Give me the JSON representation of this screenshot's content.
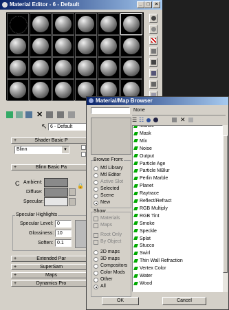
{
  "material_editor": {
    "title": "Material Editor - 6 - Default",
    "caption_buttons": [
      "_",
      "□",
      "×"
    ],
    "material_name": "6 - Default",
    "shader_rollout": "Shader Basic P",
    "shader_type": "Blinn",
    "blinn_rollout": "Blinn Basic Pa",
    "ambient_label": "Ambient:",
    "diffuse_label": "Diffuse:",
    "specular_label": "Specular:",
    "spec_highlights_label": "Specular Highlights",
    "specular_level_label": "Specular Level:",
    "specular_level_value": "0",
    "glossiness_label": "Glossiness:",
    "glossiness_value": "10",
    "soften_label": "Soften:",
    "soften_value": "0.1",
    "lower_rollouts": [
      "Extended Par",
      "SuperSam",
      "Maps",
      "Dynamics Pro"
    ],
    "pm": "+",
    "corner_label": "C"
  },
  "browser": {
    "title": "Material/Map Browser",
    "search_value": "",
    "none_label": "None",
    "browse_from_label": "Browse From:",
    "browse_from": [
      {
        "label": "Mtl Library",
        "selected": false,
        "disabled": false
      },
      {
        "label": "Mtl Editor",
        "selected": false,
        "disabled": false
      },
      {
        "label": "Active Slot",
        "selected": false,
        "disabled": true
      },
      {
        "label": "Selected",
        "selected": false,
        "disabled": false
      },
      {
        "label": "Scene",
        "selected": false,
        "disabled": false
      },
      {
        "label": "New",
        "selected": true,
        "disabled": false
      }
    ],
    "show_label": "Show",
    "show_checks": [
      {
        "label": "Materials",
        "disabled": true
      },
      {
        "label": "Maps",
        "disabled": true
      }
    ],
    "root_checks": [
      {
        "label": "Root Only",
        "disabled": true
      },
      {
        "label": "By Object",
        "disabled": true
      }
    ],
    "map_types": [
      {
        "label": "2D maps",
        "selected": false
      },
      {
        "label": "3D maps",
        "selected": false
      },
      {
        "label": "Compositors",
        "selected": false
      },
      {
        "label": "Color Mods",
        "selected": false
      },
      {
        "label": "Other",
        "selected": false
      },
      {
        "label": "All",
        "selected": true
      }
    ],
    "items": [
      "Marble",
      "Mask",
      "Mix",
      "Noise",
      "Output",
      "Particle Age",
      "Particle MBlur",
      "Perlin Marble",
      "Planet",
      "Raytrace",
      "Reflect/Refract",
      "RGB Multiply",
      "RGB Tint",
      "Smoke",
      "Speckle",
      "Splat",
      "Stucco",
      "Swirl",
      "Thin Wall Refraction",
      "Vertex Color",
      "Water",
      "Wood"
    ],
    "ok_label": "OK",
    "cancel_label": "Cancel"
  },
  "colors": {
    "title_active": "#0a246a",
    "panel": "#d4d0c8",
    "map_icon": "#00aa00"
  }
}
